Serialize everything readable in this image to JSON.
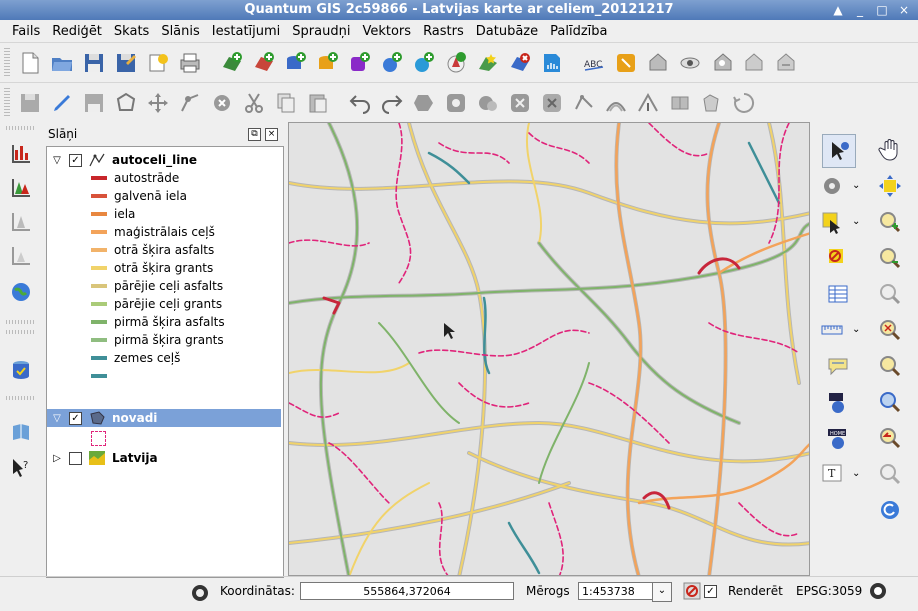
{
  "window": {
    "title": "Quantum GIS 2c59866 - Latvijas karte ar celiem_20121217",
    "controls": [
      "▲",
      "_",
      "□",
      "×"
    ]
  },
  "menubar": {
    "items": [
      {
        "label": "Fails",
        "key": "F"
      },
      {
        "label": "Rediģēt",
        "key": "R"
      },
      {
        "label": "Skats",
        "key": "S"
      },
      {
        "label": "Slānis",
        "key": "S"
      },
      {
        "label": "Iestatījumi",
        "key": "I"
      },
      {
        "label": "Spraudņi",
        "key": "S"
      },
      {
        "label": "Vektors",
        "key": "V"
      },
      {
        "label": "Rastrs",
        "key": "R"
      },
      {
        "label": "Datubāze",
        "key": "D"
      },
      {
        "label": "Palīdzība",
        "key": "P"
      }
    ]
  },
  "layers_panel": {
    "title": "Slāņi",
    "layers": [
      {
        "name": "autoceli_line",
        "checked": true,
        "expanded": true,
        "selected": false
      },
      {
        "name": "novadi",
        "checked": true,
        "expanded": true,
        "selected": true
      },
      {
        "name": "Latvija",
        "checked": false,
        "expanded": false,
        "selected": false
      }
    ],
    "legend": [
      {
        "label": "autostrāde",
        "color": "#c8262b"
      },
      {
        "label": "galvenā iela",
        "color": "#d8523a"
      },
      {
        "label": "iela",
        "color": "#e8873f"
      },
      {
        "label": "maģistrālais ceļš",
        "color": "#f3a35a"
      },
      {
        "label": "otrā šķira asfalts",
        "color": "#f2b36a"
      },
      {
        "label": "otrā šķira grants",
        "color": "#f1d36a"
      },
      {
        "label": "pārējie ceļi asfalts",
        "color": "#d9c57a"
      },
      {
        "label": "pārējie ceļi grants",
        "color": "#aacb78"
      },
      {
        "label": "pirmā šķira asfalts",
        "color": "#7fb36a"
      },
      {
        "label": "pirmā šķira grants",
        "color": "#8fbd80"
      },
      {
        "label": "zemes ceļš",
        "color": "#3f8f98"
      },
      {
        "label": "",
        "color": "#3f8f98"
      }
    ]
  },
  "statusbar": {
    "coords_label": "Koordinātas:",
    "coords_value": "555864,372064",
    "scale_label": "Mērogs",
    "scale_value": "1:453738",
    "render_label": "Renderēt",
    "render_checked": true,
    "crs": "EPSG:3059"
  },
  "colors": {
    "map_background": "#e3e3e3",
    "boundary": "#e0247a",
    "title_gradient_top": "#7ea0d0",
    "title_gradient_bottom": "#4f79b8",
    "selection": "#7ba1d8"
  }
}
